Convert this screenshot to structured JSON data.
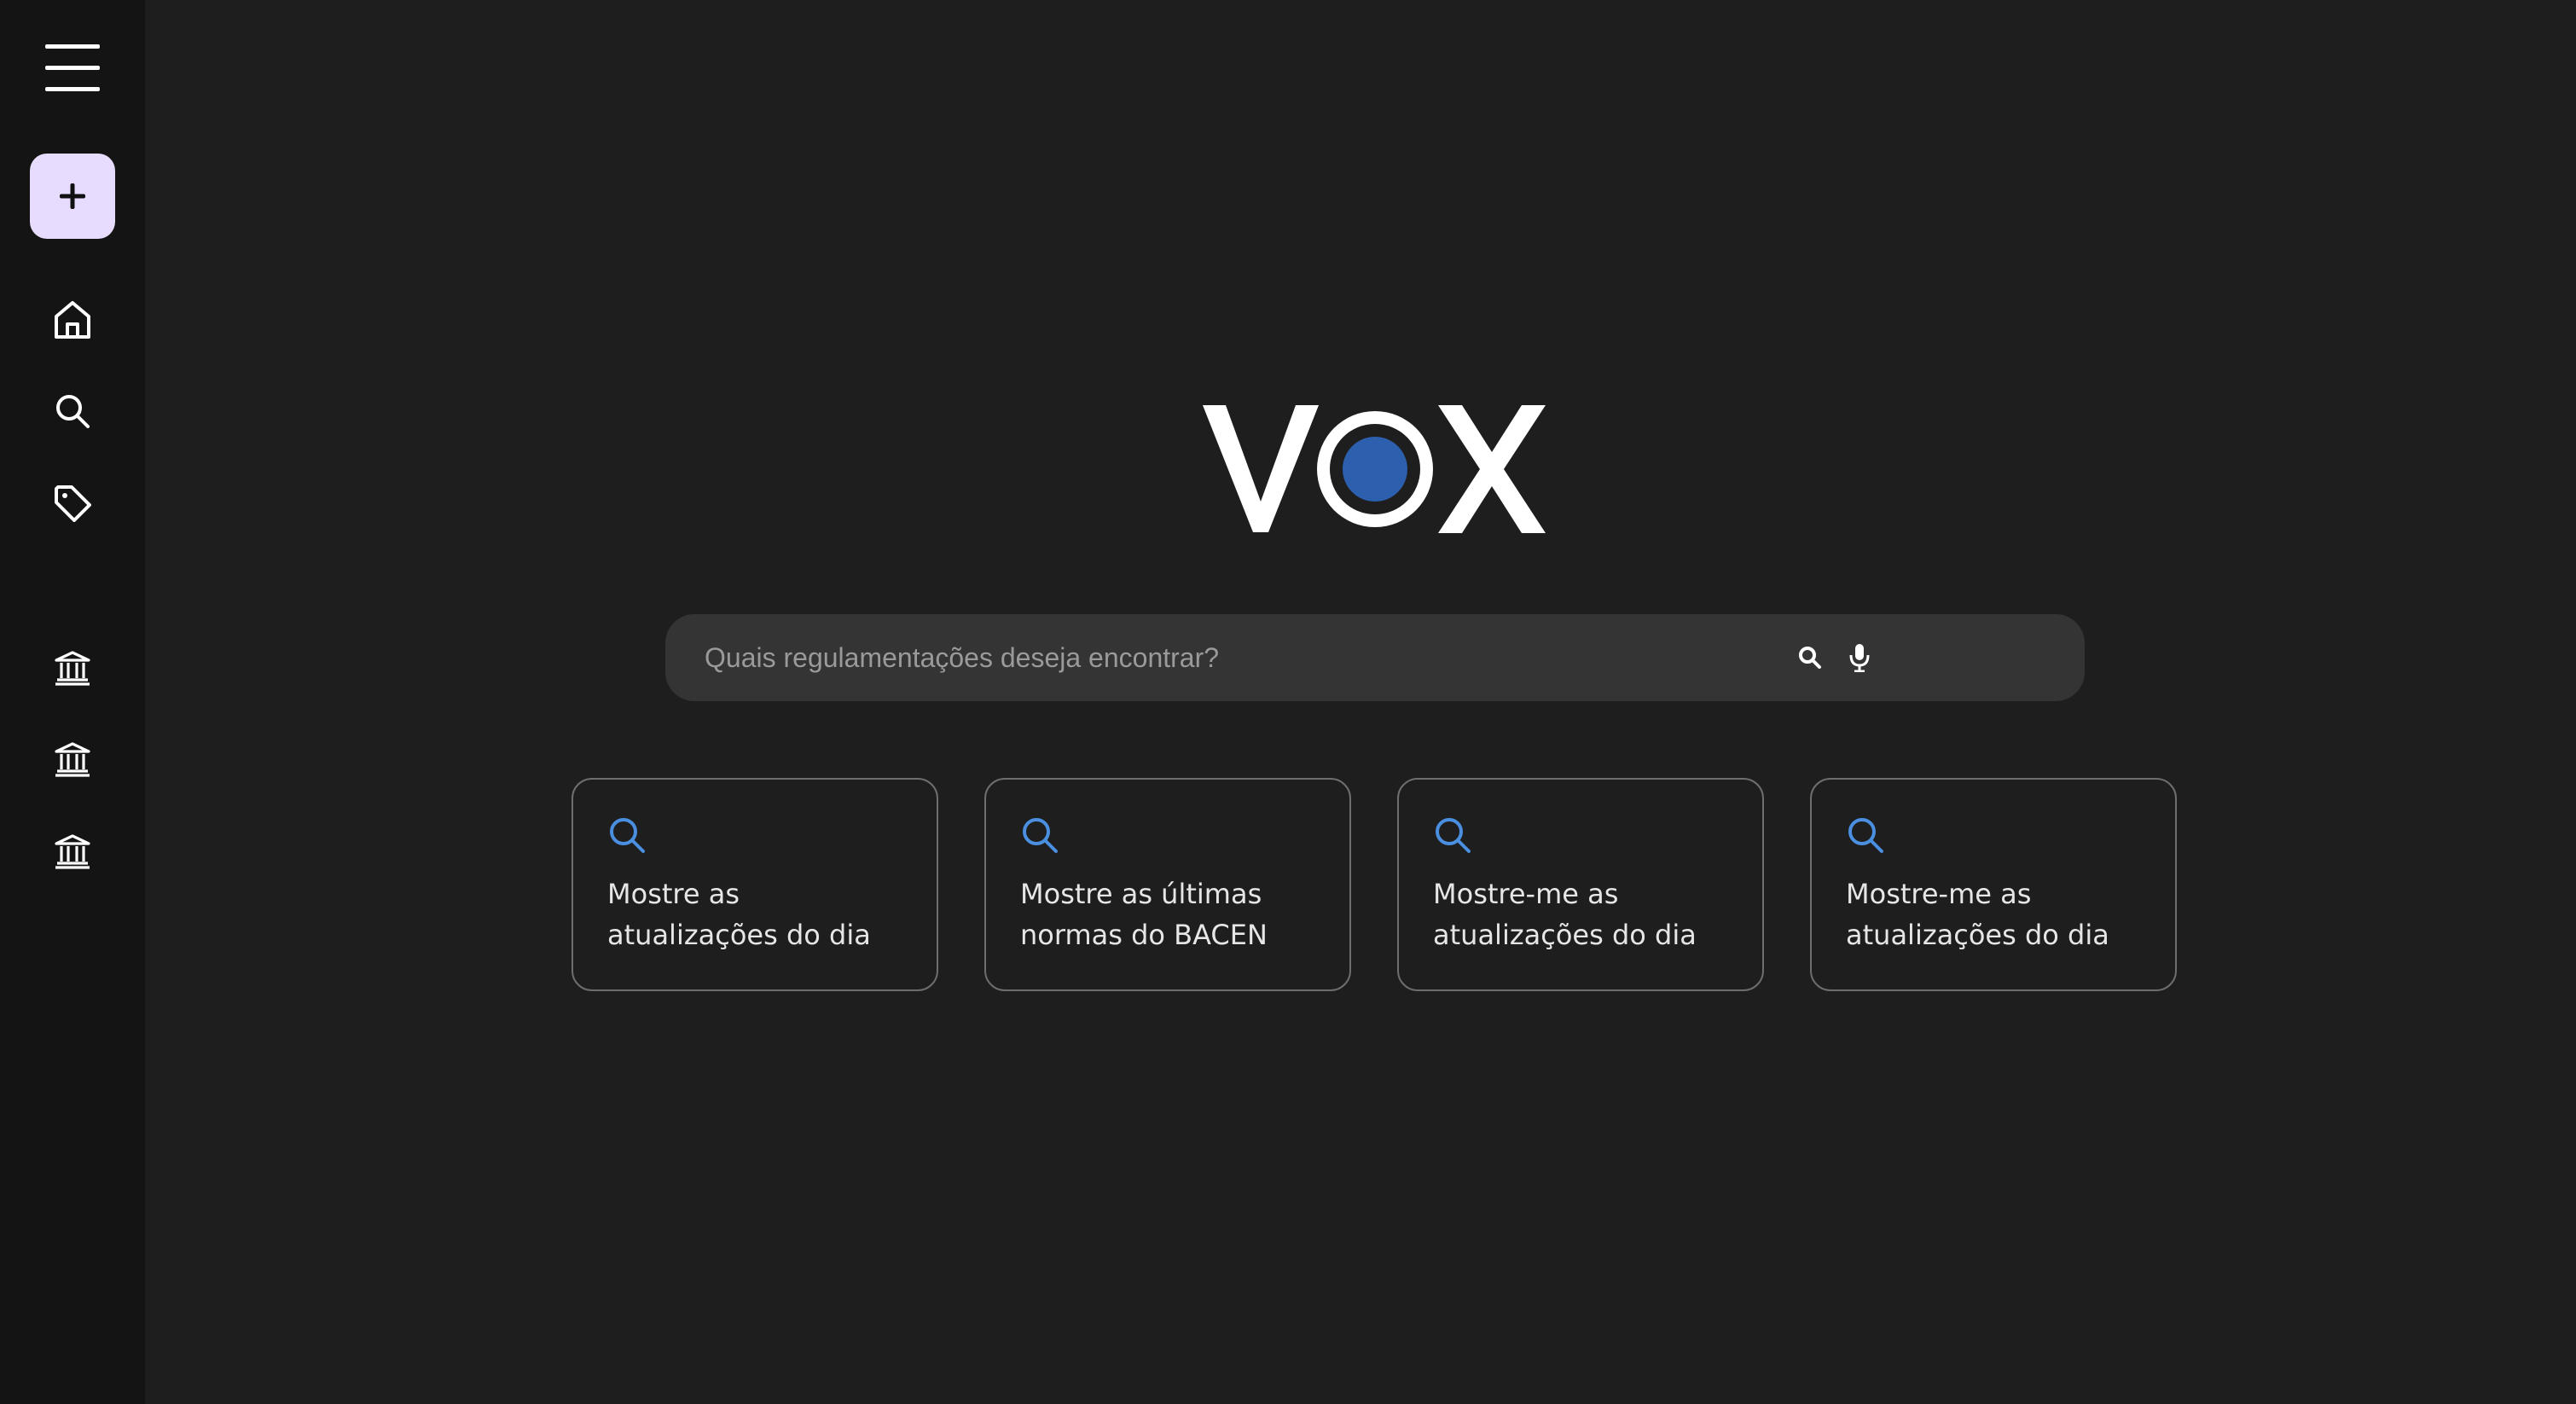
{
  "sidebar": {
    "items": [
      {
        "name": "menu",
        "icon": "menu-icon"
      },
      {
        "name": "new",
        "icon": "plus-icon"
      },
      {
        "name": "home",
        "icon": "home-icon"
      },
      {
        "name": "search",
        "icon": "search-icon"
      },
      {
        "name": "tags",
        "icon": "tag-icon"
      },
      {
        "name": "institution-1",
        "icon": "bank-icon"
      },
      {
        "name": "institution-2",
        "icon": "bank-icon"
      },
      {
        "name": "institution-3",
        "icon": "bank-icon"
      }
    ],
    "new_button_color": "#e7dcfd"
  },
  "logo": {
    "text": "VOX",
    "dot_color": "#2c5fad"
  },
  "search": {
    "placeholder": "Quais regulamentações deseja encontrar?",
    "value": "",
    "icons": [
      "search-icon",
      "microphone-icon"
    ]
  },
  "suggestions": [
    {
      "line1": "Mostre as",
      "line2": "atualizações do dia",
      "icon": "search-icon"
    },
    {
      "line1": "Mostre as últimas",
      "line2": "normas do BACEN",
      "icon": "search-icon"
    },
    {
      "line1": "Mostre-me as",
      "line2": "atualizações do dia",
      "icon": "search-icon"
    },
    {
      "line1": "Mostre-me as",
      "line2": "atualizações do dia",
      "icon": "search-icon"
    }
  ],
  "colors": {
    "background": "#1e1e1e",
    "sidebar": "#141414",
    "accent_blue": "#4a8fe0",
    "search_bar": "#343434"
  }
}
